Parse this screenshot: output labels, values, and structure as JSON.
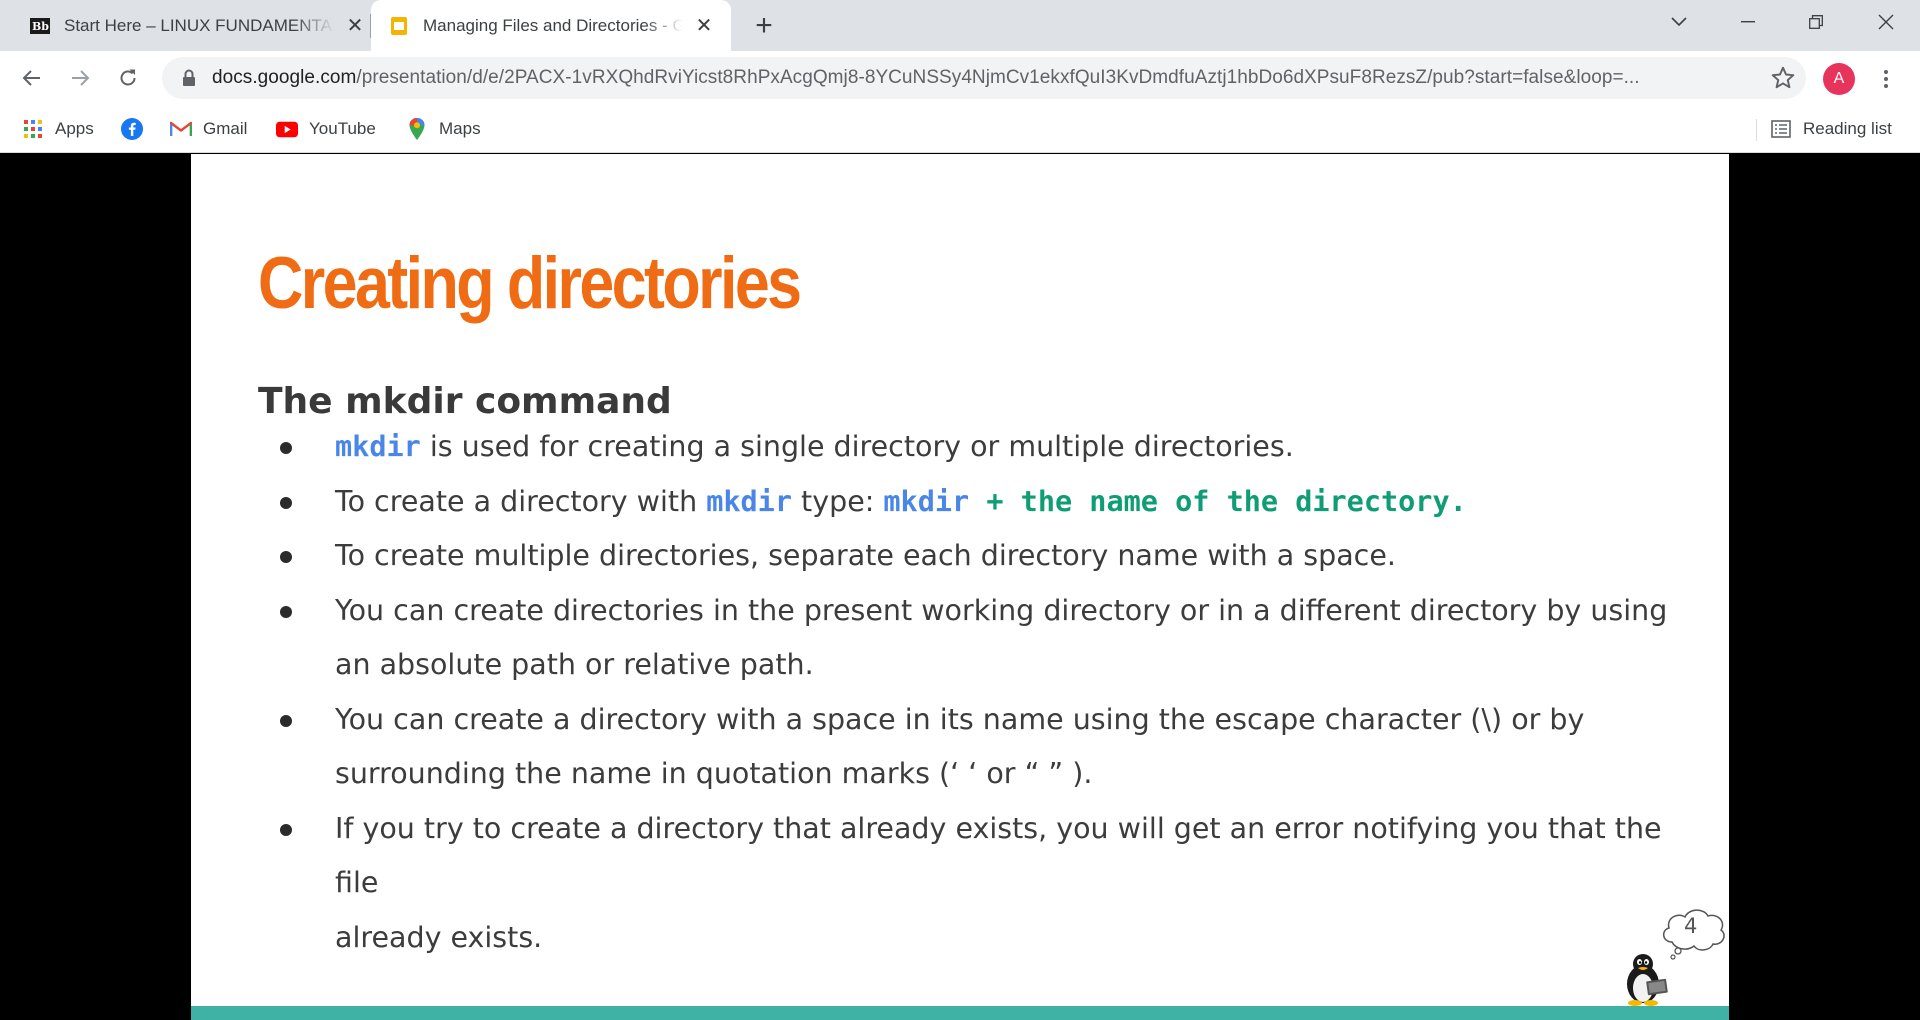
{
  "browser": {
    "tabs": [
      {
        "title": "Start Here – LINUX FUNDAMENTALS",
        "favicon": "blackboard-icon",
        "active": false
      },
      {
        "title": "Managing Files and Directories - Google Slides",
        "favicon": "google-slides-icon",
        "active": true
      }
    ],
    "url_host": "docs.google.com",
    "url_path": "/presentation/d/e/2PACX-1vRXQhdRviYicst8RhPxAcgQmj8-8YCuNSSy4NjmCv1ekxfQuI3KvDmdfuAztj1hbDo6dXPsuF8RezsZ/pub?start=false&loop=...",
    "profile_initial": "A",
    "profile_color": "#e8335d",
    "bookmarks": [
      {
        "label": "Apps",
        "icon": "apps-grid-icon"
      },
      {
        "label": "",
        "icon": "facebook-icon"
      },
      {
        "label": "Gmail",
        "icon": "gmail-icon"
      },
      {
        "label": "YouTube",
        "icon": "youtube-icon"
      },
      {
        "label": "Maps",
        "icon": "maps-icon"
      }
    ],
    "reading_list": "Reading list"
  },
  "slide": {
    "title": "Creating directories",
    "subheading": "The mkdir command",
    "bullets": [
      {
        "code": "mkdir",
        "text": " is used for creating a single directory or multiple directories."
      },
      {
        "pre": "To create a directory with ",
        "code1": "mkdir",
        "mid": " type: ",
        "code2": "mkdir",
        "code3": " + the name of the directory."
      },
      {
        "text": "To create multiple directories, separate each directory name with a space."
      },
      {
        "line1": "You can create directories in the present working directory or in a different directory by using",
        "line2": "an absolute path or relative path."
      },
      {
        "line1": "You can create a directory with a space in its name using the escape character (\\) or by",
        "line2": "surrounding the name in quotation marks (‘ ‘ or “ ” )."
      },
      {
        "line1": "If you try to create a directory that already exists, you will get an error notifying you that the file",
        "line2": "already exists."
      }
    ],
    "page_number": "4",
    "colors": {
      "title": "#ef6c14",
      "code": "#4a86e8",
      "code_green": "#0f9d76",
      "footer": "#3fb2a5"
    }
  }
}
